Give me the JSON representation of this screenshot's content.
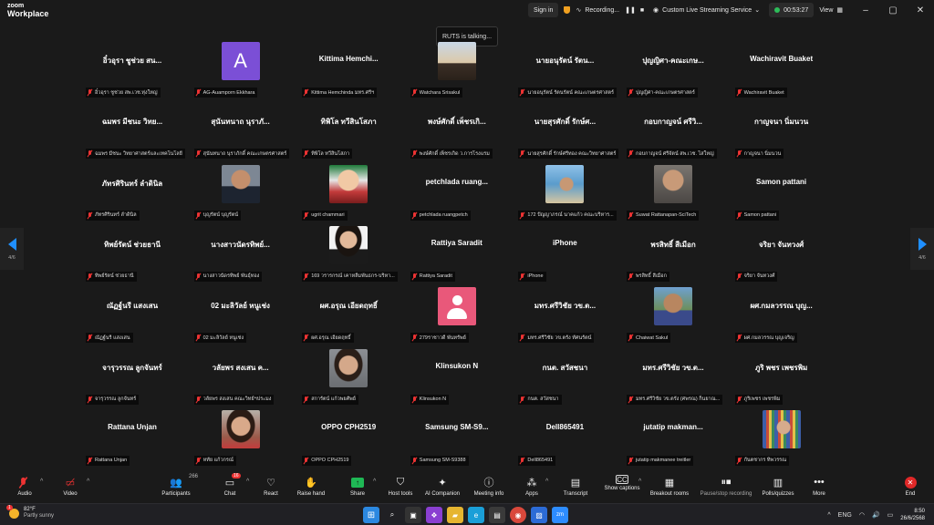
{
  "app": {
    "title_line1": "zoom",
    "title_line2": "Workplace"
  },
  "titlebar": {
    "sign_in": "Sign in",
    "recording": "Recording...",
    "service": "Custom Live Streaming Service",
    "timer": "00:53:27",
    "view": "View"
  },
  "talking": "RUTS is talking...",
  "paging": {
    "left": "4/6",
    "right": "4/6"
  },
  "tiles": [
    {
      "row": 0,
      "col": 0,
      "center": "อิ๋วอุรา ชูช่วย สน...",
      "label": "อิ๋วอุรา ชูช่วย สพ.เวช.ทุ่งใหญ่",
      "avatar": "none"
    },
    {
      "row": 0,
      "col": 1,
      "center": "",
      "label": "AG-Auamporn Ekkhara",
      "avatar": "letter",
      "letter": "A"
    },
    {
      "row": 0,
      "col": 2,
      "center": "Kittima  Hemchi...",
      "label": "Kittima Hemchinda มทร.ศรีฯ",
      "avatar": "none"
    },
    {
      "row": 0,
      "col": 3,
      "center": "",
      "label": "Watchara Srisakul",
      "avatar": "photo",
      "photo": "sunset"
    },
    {
      "row": 0,
      "col": 4,
      "center": "นายอนุรัตน์  รัตน...",
      "label": "นายอนุรัตน์ รัตนรัตน์ คณะเกษตรศาสตร์",
      "avatar": "none"
    },
    {
      "row": 0,
      "col": 5,
      "center": "ปุญญิศา-คณะเกษ...",
      "label": "ปุญญิศา-คณะเกษตรศาสตร์",
      "avatar": "none"
    },
    {
      "row": 0,
      "col": 6,
      "center": "Wachiravit Buaket",
      "label": "Wachiravit Buaket",
      "avatar": "none"
    },
    {
      "row": 1,
      "col": 0,
      "center": "ฉมพร มีชนะ วิทย...",
      "label": "ฉมพร มีชนะ วิทยาศาสตร์และเทคโนโลยี",
      "avatar": "none"
    },
    {
      "row": 1,
      "col": 1,
      "center": "สุนันทนาถ นุราภั...",
      "label": "สุนันทนาถ นุราภักดิ์ คณะเกษตรศาสตร์",
      "avatar": "none"
    },
    {
      "row": 1,
      "col": 2,
      "center": "ทิพิโล ทวีสินโสภา",
      "label": "ทิพิโล ทวีสินโสภา",
      "avatar": "none"
    },
    {
      "row": 1,
      "col": 3,
      "center": "พงษ์ศักดิ์ เพ็ชรเกิ...",
      "label": "พงษ์ศักดิ์ เพ็ชรเกิด ว.การโรงแรม",
      "avatar": "none"
    },
    {
      "row": 1,
      "col": 4,
      "center": "นายสุรศักดิ์ รักษ์ศ...",
      "label": "นายสุรศักดิ์ รักษ์ศรีทอง คณะวิทยาศาสตร์",
      "avatar": "none"
    },
    {
      "row": 1,
      "col": 5,
      "center": "กอบกาญจน์ ศรีวิ...",
      "label": "กอบกาญจน์ ศรีจัตน์ สพ.เวช. ไสใหญ่",
      "avatar": "none"
    },
    {
      "row": 1,
      "col": 6,
      "center": "กาญจนา นิ่มนวน",
      "label": "กาญจนา นิ่มนวน",
      "avatar": "none"
    },
    {
      "row": 2,
      "col": 0,
      "center": "ภัทรศิรินทร์ ลำดินิล",
      "label": "ภัทรศิรินทร์ ลำดินิล",
      "avatar": "none"
    },
    {
      "row": 2,
      "col": 1,
      "center": "",
      "label": "บุญรัตน์ บุญรัตน์",
      "avatar": "photo",
      "photo": "man-suit"
    },
    {
      "row": 2,
      "col": 2,
      "center": "",
      "label": "ugrit chammari",
      "avatar": "photo",
      "photo": "cartoon"
    },
    {
      "row": 2,
      "col": 3,
      "center": "petchlada  ruang...",
      "label": "petchlada ruangpetch",
      "avatar": "none"
    },
    {
      "row": 2,
      "col": 4,
      "center": "",
      "label": "172 ปัญญาภรณ์ นาคแก้ว คณะบริหาร...",
      "avatar": "photo",
      "photo": "beach"
    },
    {
      "row": 2,
      "col": 5,
      "center": "",
      "label": "Suwat Rattanapan-SciTech",
      "avatar": "photo",
      "photo": "man-glasses"
    },
    {
      "row": 2,
      "col": 6,
      "center": "Samon pattani",
      "label": "Samon pattani",
      "avatar": "none"
    },
    {
      "row": 3,
      "col": 0,
      "center": "ทิพย์รัตน์ ช่วยธานี",
      "label": "ทิพย์รัตน์ ช่วยธานี",
      "avatar": "none"
    },
    {
      "row": 3,
      "col": 1,
      "center": "นางสาวนัดรทิพย์...",
      "label": "นางสาวนัดรทิพย์ พันธุ์ทอง",
      "avatar": "none"
    },
    {
      "row": 3,
      "col": 2,
      "center": "",
      "label": "169 วรารกรณ์ เคาหลีมพันธกร-บริหา...",
      "avatar": "photo",
      "photo": "woman-suit"
    },
    {
      "row": 3,
      "col": 3,
      "center": "Rattiya Saradit",
      "label": "Rattiya Saradit",
      "avatar": "none"
    },
    {
      "row": 3,
      "col": 4,
      "center": "iPhone",
      "label": "iPhone",
      "avatar": "none"
    },
    {
      "row": 3,
      "col": 5,
      "center": "พรสิทธิ์ สีเมือก",
      "label": "พรสิทธิ์ สีเมือก",
      "avatar": "none"
    },
    {
      "row": 3,
      "col": 6,
      "center": "จริยา จันทวงศ์",
      "label": "จริยา จันทวงศ์",
      "avatar": "none"
    },
    {
      "row": 4,
      "col": 0,
      "center": "ณัฏฐ์นรี แสงเสน",
      "label": "ณัฏฐ์นรี แสงเสน",
      "avatar": "none"
    },
    {
      "row": 4,
      "col": 1,
      "center": "02 มะลิวัลย์  หนูเช่ง",
      "label": "02 มะลิวัลย์ หนูเช่ง",
      "avatar": "none"
    },
    {
      "row": 4,
      "col": 2,
      "center": "ผศ.อรุณ เอียดฤทธิ์",
      "label": "ผศ.อรุณ เอียดฤทธิ์",
      "avatar": "none"
    },
    {
      "row": 4,
      "col": 3,
      "center": "",
      "label": "279ราชาวดี พันทรัพย์",
      "avatar": "pink"
    },
    {
      "row": 4,
      "col": 4,
      "center": "มทร.ศรีวิชัย วข.ต...",
      "label": "มทร.ศรีวิชัย วข.ตรัง ทัศนรัตน์",
      "avatar": "none"
    },
    {
      "row": 4,
      "col": 5,
      "center": "",
      "label": "Chaiwat Sakul",
      "avatar": "photo",
      "photo": "man-outdoor"
    },
    {
      "row": 4,
      "col": 6,
      "center": "ผศ.กมลวรรณ บุญ...",
      "label": "ผศ.กมลวรรณ บุญเจริญ",
      "avatar": "none"
    },
    {
      "row": 5,
      "col": 0,
      "center": "จารุวรรณ ลูกจันทร์",
      "label": "จารุวรรณ ลูกจันทร์",
      "avatar": "none"
    },
    {
      "row": 5,
      "col": 1,
      "center": "วลัยพร สงเสน ค...",
      "label": "วลัยพร สงเสน คณะวิทย์ฯประมง",
      "avatar": "none"
    },
    {
      "row": 5,
      "col": 2,
      "center": "",
      "label": "สการัตน์ แก้วพยศัพย์",
      "avatar": "photo",
      "photo": "woman-glasses"
    },
    {
      "row": 5,
      "col": 3,
      "center": "Klinsukon N",
      "label": "Klinsukon N",
      "avatar": "none"
    },
    {
      "row": 5,
      "col": 4,
      "center": "กนต. สวัสชนา",
      "label": "กนต. สวัสชนา",
      "avatar": "none"
    },
    {
      "row": 5,
      "col": 5,
      "center": "มทร.ศรีวิชัย วข.ต...",
      "label": "มทร.ศรีวิชัย วข.ตรัง (ศพรณ) ก็นยาณ...",
      "avatar": "none"
    },
    {
      "row": 5,
      "col": 6,
      "center": "ภูริ พชร เพชรพิม",
      "label": "ภูริเพชร เพชรพิม",
      "avatar": "none"
    },
    {
      "row": 6,
      "col": 0,
      "center": "Rattana Unjan",
      "label": "Rattana Unjan",
      "avatar": "none"
    },
    {
      "row": 6,
      "col": 1,
      "center": "",
      "label": "หทัย แก้วกรณ์",
      "avatar": "photo",
      "photo": "woman-red"
    },
    {
      "row": 6,
      "col": 2,
      "center": "OPPO CPH2519",
      "label": "OPPO CPH2519",
      "avatar": "none"
    },
    {
      "row": 6,
      "col": 3,
      "center": "Samsung  SM-S9...",
      "label": "Samsung SM-S9388",
      "avatar": "none"
    },
    {
      "row": 6,
      "col": 4,
      "center": "Dell865491",
      "label": "Dell865491",
      "avatar": "none"
    },
    {
      "row": 6,
      "col": 5,
      "center": "jutatip  makman...",
      "label": "jutatip makmanee treitler",
      "avatar": "none"
    },
    {
      "row": 6,
      "col": 6,
      "center": "",
      "label": "กันตชากร ทิพวรรณ",
      "avatar": "photo",
      "photo": "library"
    }
  ],
  "toolbar": {
    "audio": "Audio",
    "video": "Video",
    "participants": "Participants",
    "participants_count": "266",
    "chat": "Chat",
    "chat_badge": "16",
    "react": "React",
    "raise_hand": "Raise hand",
    "share": "Share",
    "host_tools": "Host tools",
    "ai_companion": "AI Companion",
    "meeting_info": "Meeting info",
    "apps": "Apps",
    "transcript": "Transcript",
    "captions": "Show captions",
    "breakout": "Breakout rooms",
    "pause_recording": "Pause/stop recording",
    "polls": "Polls/quizzes",
    "more": "More",
    "end": "End"
  },
  "taskbar": {
    "temp": "82°F",
    "weather": "Partly sunny",
    "weather_badge": "1",
    "lang": "ENG",
    "time": "8:50",
    "date": "26/6/2568"
  },
  "colors": {
    "accent": "#1f8fff",
    "muted_red": "#e33",
    "zoom_purple": "#7b4fd6",
    "pink_avatar": "#e9587a",
    "share_green": "#1fb855"
  }
}
